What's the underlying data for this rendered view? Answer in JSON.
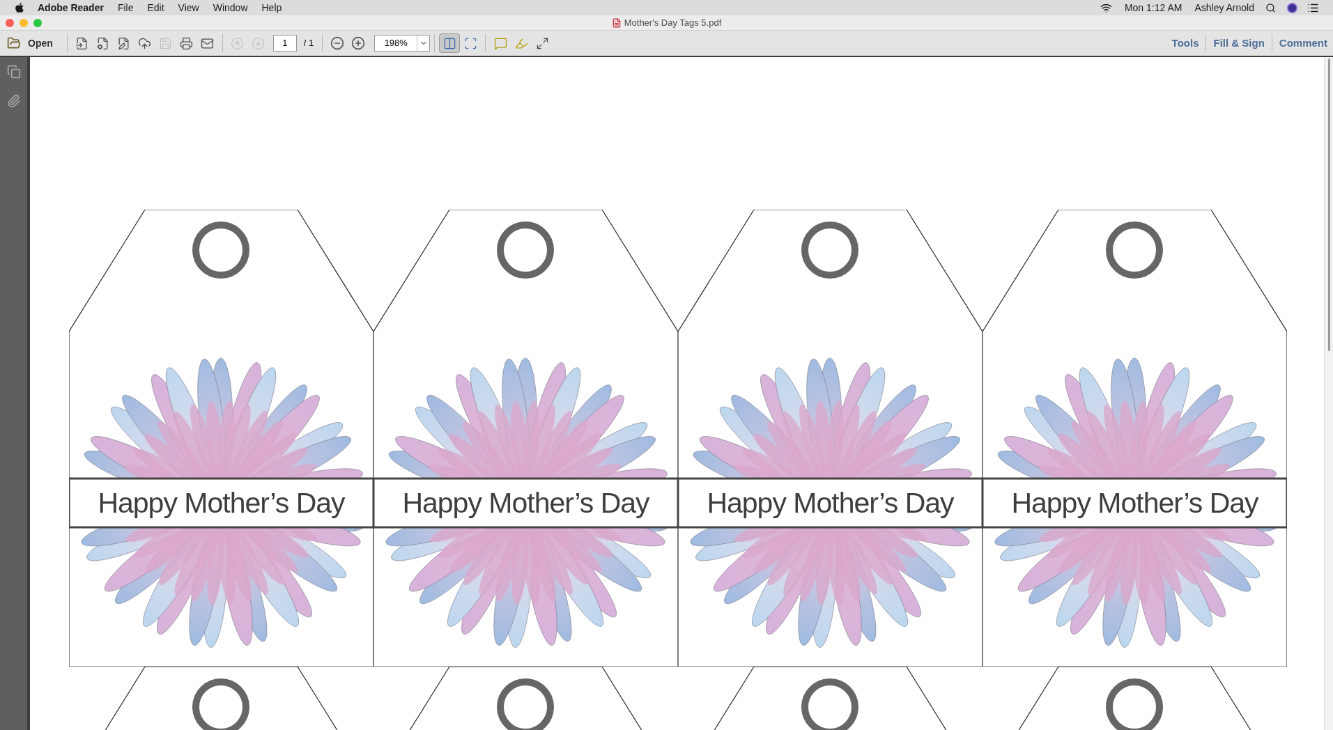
{
  "menu_bar": {
    "app_name": "Adobe Reader",
    "menus": [
      "File",
      "Edit",
      "View",
      "Window",
      "Help"
    ],
    "clock": "Mon 1:12 AM",
    "user": "Ashley Arnold"
  },
  "window": {
    "title": "Mother's Day Tags 5.pdf"
  },
  "toolbar": {
    "open_label": "Open",
    "file_tools": [
      {
        "kind": "create",
        "disabled": false
      },
      {
        "kind": "export",
        "disabled": false
      },
      {
        "kind": "edit",
        "disabled": false
      },
      {
        "kind": "upload",
        "disabled": false
      },
      {
        "kind": "save",
        "disabled": true
      },
      {
        "kind": "print",
        "disabled": false
      },
      {
        "kind": "email",
        "disabled": false
      }
    ],
    "page_nav": [
      {
        "kind": "previous",
        "disabled": true
      },
      {
        "kind": "next",
        "disabled": true
      }
    ],
    "page_number": "1",
    "page_total": "/ 1",
    "zoom": "198%",
    "view_tools": [
      {
        "kind": "fit-page",
        "selected": true
      },
      {
        "kind": "fit-width",
        "selected": false
      }
    ],
    "annotate_tools": [
      {
        "kind": "comment"
      },
      {
        "kind": "highlight"
      },
      {
        "kind": "fullscreen"
      }
    ],
    "panels": [
      "Tools",
      "Fill & Sign",
      "Comment"
    ]
  },
  "side_rail": [
    {
      "kind": "pages"
    },
    {
      "kind": "attachments"
    }
  ],
  "document": {
    "tags": [
      {
        "kind": "full",
        "text": "Happy Mother’s Day"
      },
      {
        "kind": "full",
        "text": "Happy Mother’s Day"
      },
      {
        "kind": "full",
        "text": "Happy Mother’s Day"
      },
      {
        "kind": "full",
        "text": "Happy Mother’s Day"
      },
      {
        "kind": "top"
      },
      {
        "kind": "top"
      },
      {
        "kind": "top"
      },
      {
        "kind": "top"
      }
    ]
  }
}
